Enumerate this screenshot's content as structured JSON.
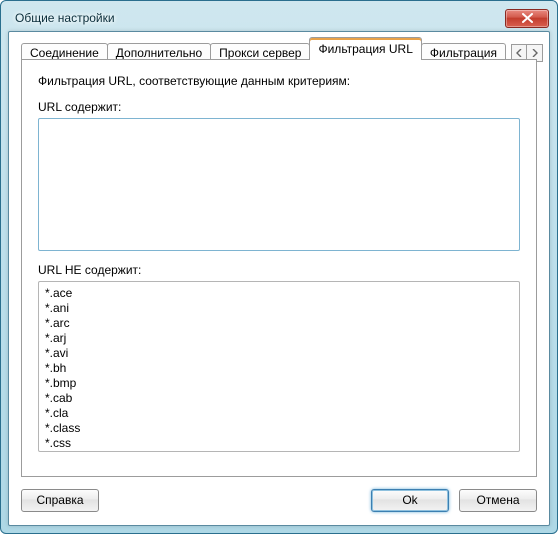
{
  "window": {
    "title": "Общие настройки"
  },
  "tabs": {
    "items": [
      {
        "label": "Соединение"
      },
      {
        "label": "Дополнительно"
      },
      {
        "label": "Прокси сервер"
      },
      {
        "label": "Фильтрация URL"
      },
      {
        "label": "Фильтрация"
      }
    ],
    "active_index": 3
  },
  "page": {
    "heading": "Фильтрация URL, соответствующие данным критериям:",
    "contains_label": "URL содержит:",
    "contains_value": "",
    "not_contains_label": "URL НЕ содержит:",
    "not_contains_value": "*.ace\n*.ani\n*.arc\n*.arj\n*.avi\n*.bh\n*.bmp\n*.cab\n*.cla\n*.class\n*.css"
  },
  "buttons": {
    "help": "Справка",
    "ok": "Ok",
    "cancel": "Отмена"
  },
  "icons": {
    "close": "close-icon"
  }
}
